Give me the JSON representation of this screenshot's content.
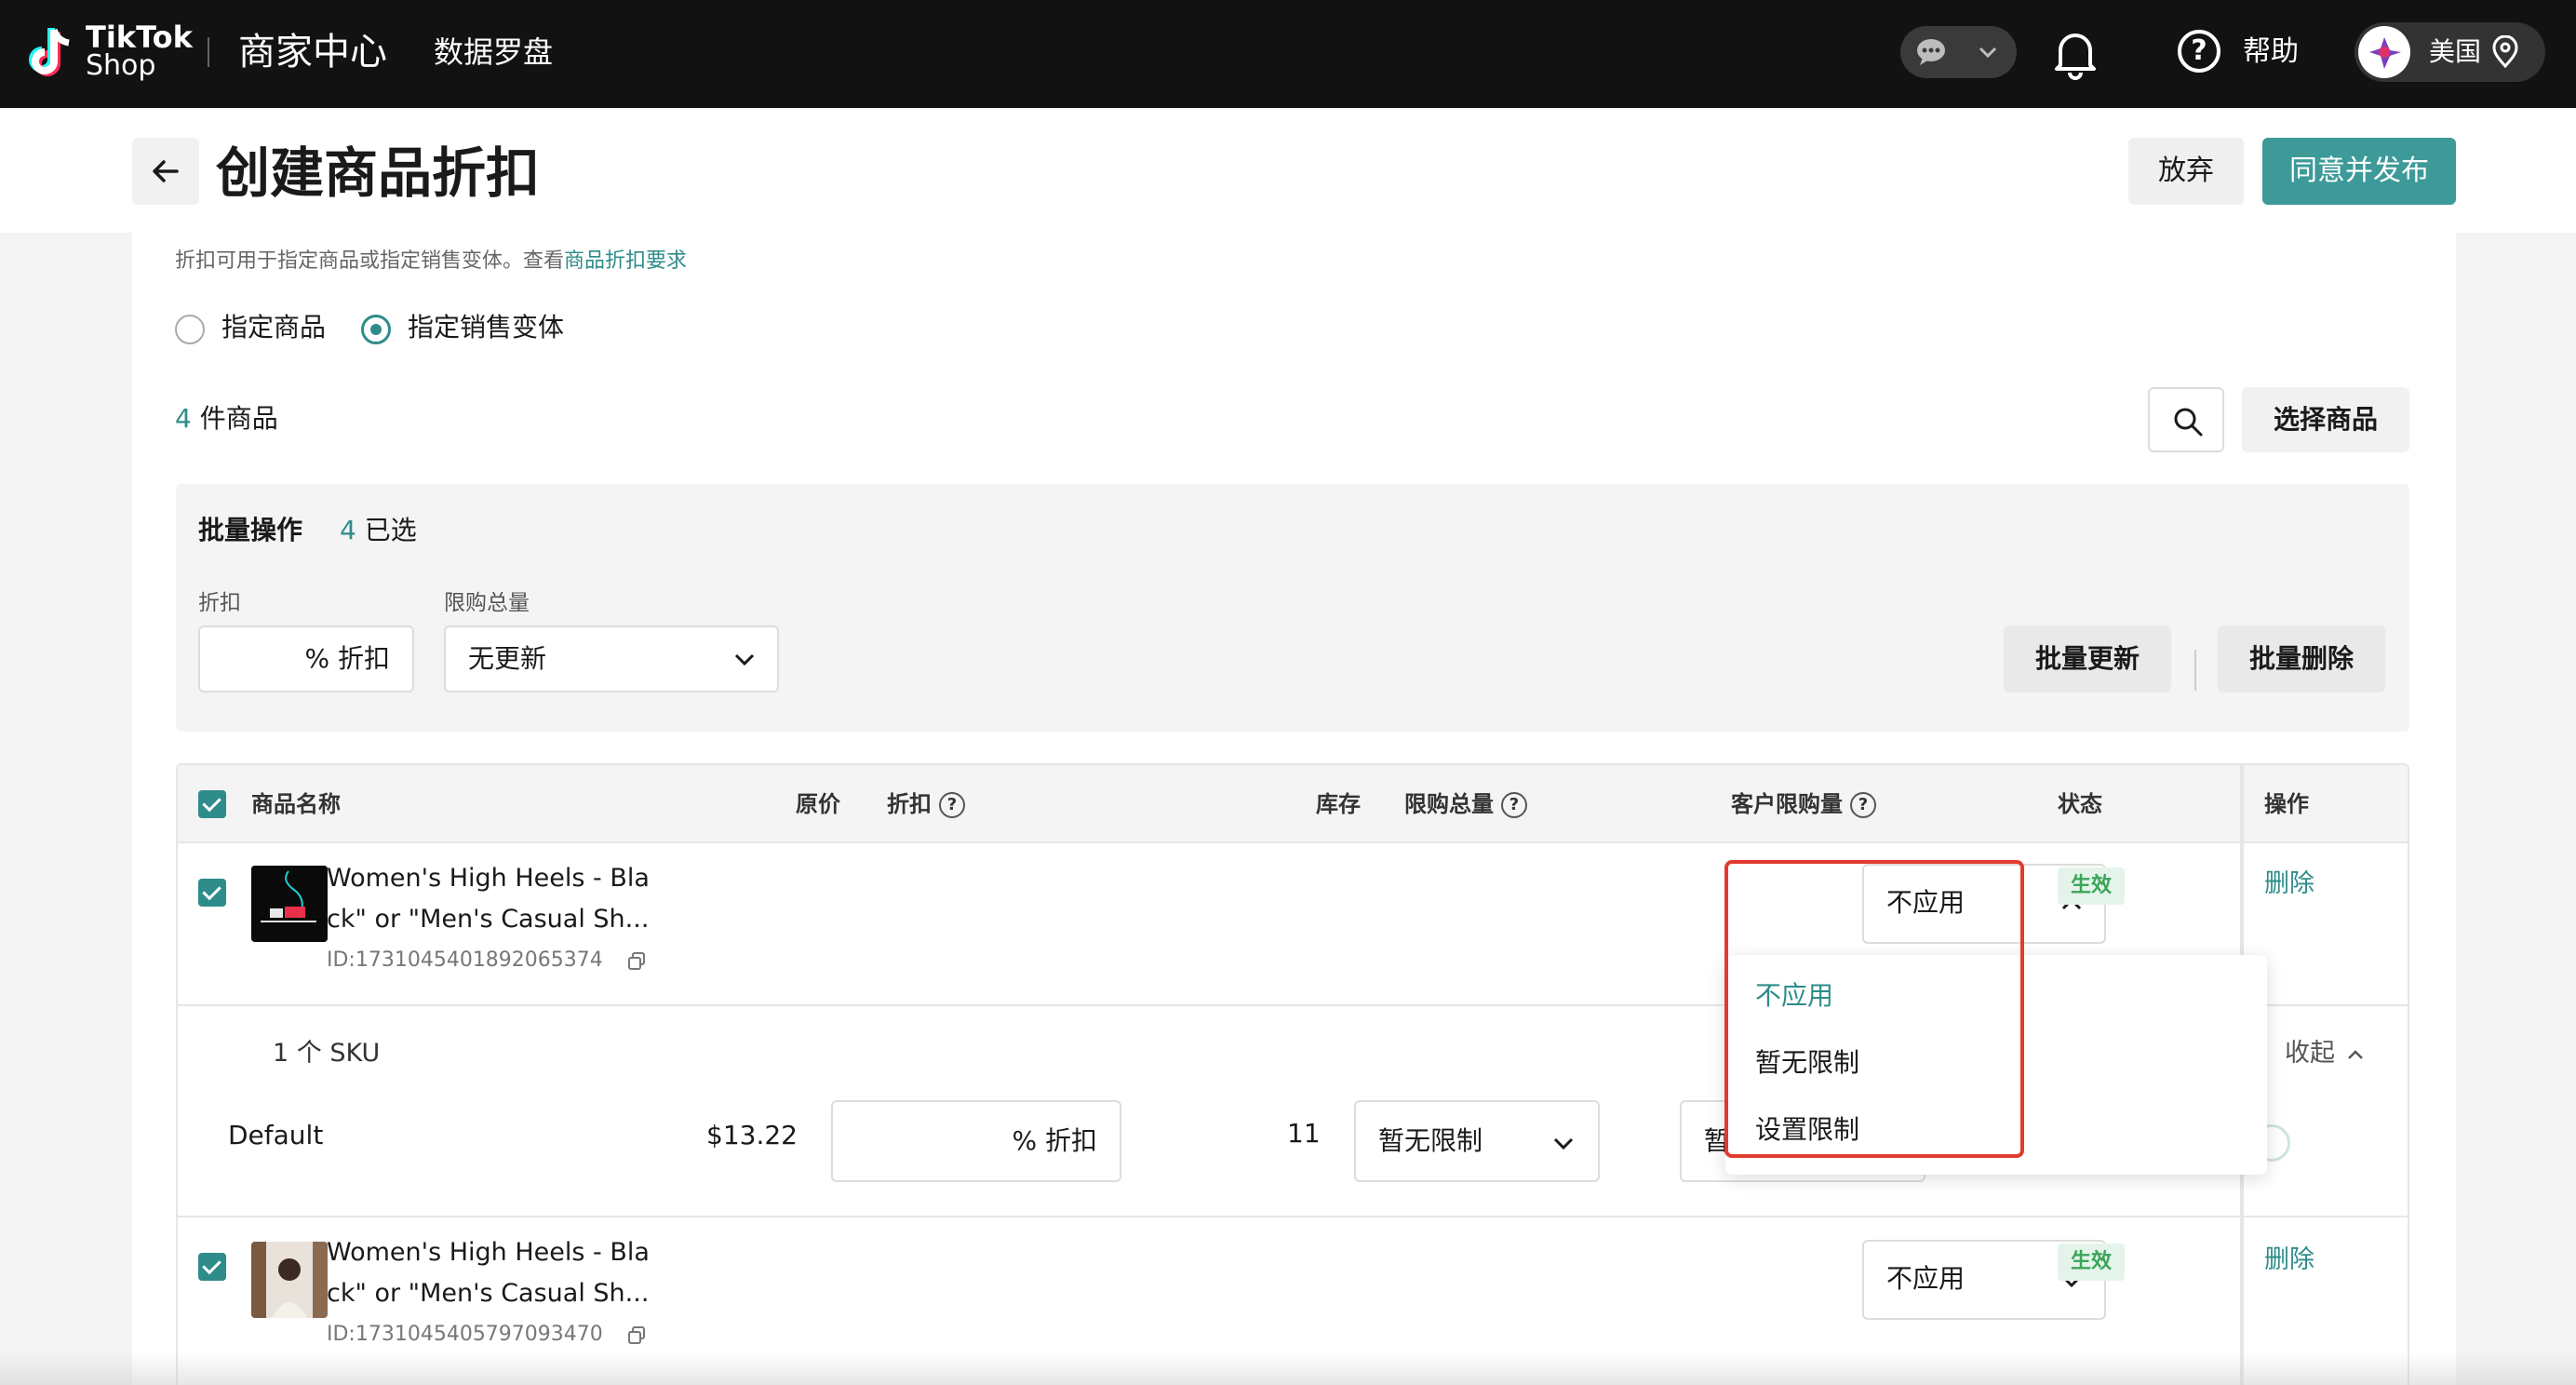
{
  "nav": {
    "logo_line1": "TikTok",
    "logo_line2": "Shop",
    "title": "商家中心",
    "data_compass": "数据罗盘",
    "help": "帮助",
    "region": "美国"
  },
  "header": {
    "title": "创建商品折扣",
    "discard": "放弃",
    "publish": "同意并发布"
  },
  "intro": {
    "text": "折扣可用于指定商品或指定销售变体。查看",
    "link": "商品折扣要求"
  },
  "radios": {
    "product": "指定商品",
    "variant": "指定销售变体",
    "selected": "指定销售变体"
  },
  "products_count": {
    "number": "4",
    "label": "件商品"
  },
  "choose_button": "选择商品",
  "batch": {
    "title": "批量操作",
    "selected_number": "4",
    "selected_label": "已选",
    "discount_label": "折扣",
    "discount_placeholder": "% 折扣",
    "limit_label": "限购总量",
    "limit_value": "无更新",
    "update_button": "批量更新",
    "delete_button": "批量删除"
  },
  "table": {
    "headers": {
      "name": "商品名称",
      "price": "原价",
      "discount": "折扣",
      "stock": "库存",
      "total_limit": "限购总量",
      "customer_limit": "客户限购量",
      "status": "状态",
      "actions": "操作"
    },
    "rows": [
      {
        "name_line1": "Women's High Heels - Bla",
        "name_line2": "ck\" or \"Men's Casual Sh...",
        "id": "ID:1731045401892065374",
        "customer_limit": "不应用",
        "status": "生效",
        "action": "删除",
        "sku_count": "1 个 SKU",
        "collapse": "收起",
        "sku": {
          "name": "Default",
          "price": "$13.22",
          "discount_placeholder": "% 折扣",
          "stock": "11",
          "total_limit": "暂无限制",
          "customer_limit_partial": "暂"
        }
      },
      {
        "name_line1": "Women's High Heels - Bla",
        "name_line2": "ck\" or \"Men's Casual Sh...",
        "id": "ID:1731045405797093470",
        "customer_limit": "不应用",
        "status": "生效",
        "action": "删除"
      }
    ]
  },
  "dropdown_options": [
    "不应用",
    "暂无限制",
    "设置限制"
  ],
  "colors": {
    "brand_teal": "#3d9a99",
    "nav_bg": "#121212",
    "highlight_red": "#e23b2e",
    "status_green": "#3aa55a"
  }
}
